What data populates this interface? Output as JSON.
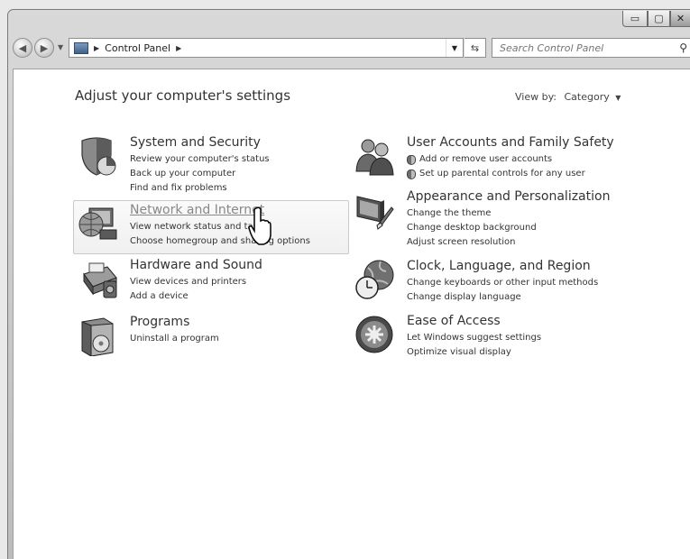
{
  "window": {
    "controls": {
      "minimize": "▭",
      "maximize": "▢",
      "close": "✕"
    }
  },
  "address_bar": {
    "breadcrumb": [
      "Control Panel"
    ],
    "search_placeholder": "Search Control Panel"
  },
  "header": {
    "title": "Adjust your computer's settings",
    "view_by_label": "View by:",
    "view_by_value": "Category"
  },
  "categories": [
    {
      "title": "System and Security",
      "icon": "shield-icon",
      "links": [
        "Review your computer's status",
        "Back up your computer",
        "Find and fix problems"
      ]
    },
    {
      "title": "Network and Internet",
      "icon": "network-globe-icon",
      "links": [
        "View network status and tasks",
        "Choose homegroup and sharing options"
      ]
    },
    {
      "title": "Hardware and Sound",
      "icon": "printer-speaker-icon",
      "links": [
        "View devices and printers",
        "Add a device"
      ]
    },
    {
      "title": "Programs",
      "icon": "programs-box-icon",
      "links": [
        "Uninstall a program"
      ]
    },
    {
      "title": "User Accounts and Family Safety",
      "icon": "users-icon",
      "links": [
        "Add or remove user accounts",
        "Set up parental controls for any user"
      ]
    },
    {
      "title": "Appearance and Personalization",
      "icon": "monitor-brush-icon",
      "links": [
        "Change the theme",
        "Change desktop background",
        "Adjust screen resolution"
      ]
    },
    {
      "title": "Clock, Language, and Region",
      "icon": "clock-globe-icon",
      "links": [
        "Change keyboards or other input methods",
        "Change display language"
      ]
    },
    {
      "title": "Ease of Access",
      "icon": "ease-of-access-icon",
      "links": [
        "Let Windows suggest settings",
        "Optimize visual display"
      ]
    }
  ]
}
